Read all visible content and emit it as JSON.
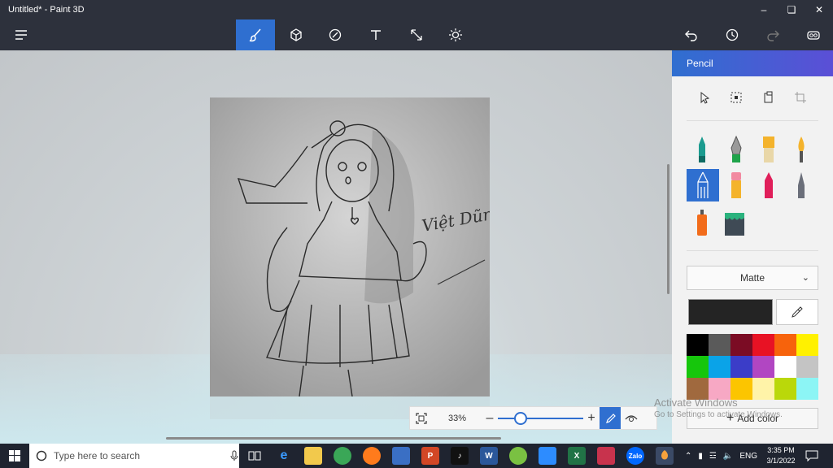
{
  "window": {
    "title": "Untitled* - Paint 3D"
  },
  "panel": {
    "title": "Pencil",
    "texture": "Matte",
    "current_color": "#242424",
    "add_color_label": "Add color",
    "palette": [
      "#000000",
      "#5a5a5a",
      "#7b0c24",
      "#e81224",
      "#f7630c",
      "#fff100",
      "#16c60c",
      "#0aa3e8",
      "#3b3dc8",
      "#b146c2",
      "#ffffff",
      "#c4c4c4",
      "#a0693e",
      "#f7a8c4",
      "#fcc500",
      "#fff3a8",
      "#bad80a",
      "#8cf5f5"
    ]
  },
  "zoom": {
    "value": "33%",
    "level": 0.33
  },
  "watermark": {
    "line1": "Activate Windows",
    "line2": "Go to Settings to activate Windows."
  },
  "taskbar": {
    "search_placeholder": "Type here to search",
    "lang": "ENG",
    "time": "3:35 PM",
    "date": "3/1/2022"
  },
  "drawing": {
    "signature": "Việt Dũng"
  }
}
